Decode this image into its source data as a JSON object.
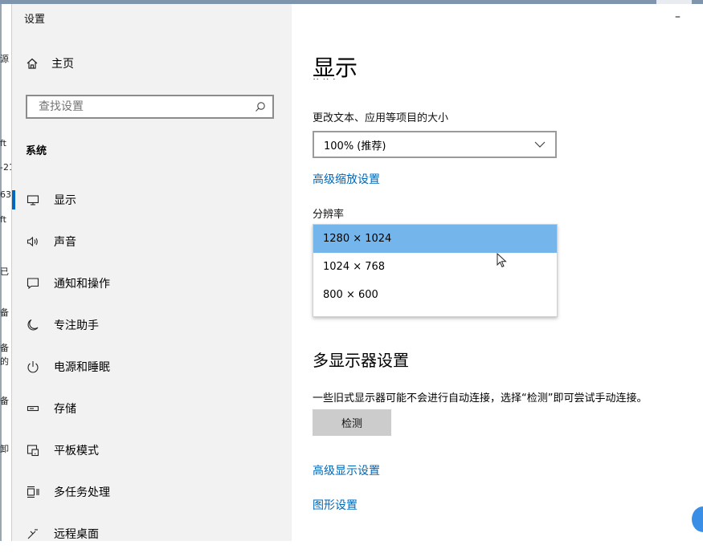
{
  "window": {
    "title": "设置",
    "minimize_glyph": "–"
  },
  "background_window": {
    "fragments": [
      "源",
      "ft",
      "-21",
      "63",
      "ft",
      "已",
      "备",
      "备",
      "的",
      "备",
      "卸"
    ]
  },
  "sidebar": {
    "home_label": "主页",
    "search_placeholder": "查找设置",
    "section_label": "系统",
    "items": [
      {
        "label": "显示",
        "icon": "monitor-icon",
        "active": true
      },
      {
        "label": "声音",
        "icon": "speaker-icon"
      },
      {
        "label": "通知和操作",
        "icon": "notification-icon"
      },
      {
        "label": "专注助手",
        "icon": "moon-icon"
      },
      {
        "label": "电源和睡眠",
        "icon": "power-icon"
      },
      {
        "label": "存储",
        "icon": "storage-icon"
      },
      {
        "label": "平板模式",
        "icon": "tablet-icon"
      },
      {
        "label": "多任务处理",
        "icon": "multitask-icon"
      },
      {
        "label": "远程桌面",
        "icon": "remote-desktop-icon"
      }
    ]
  },
  "main": {
    "title": "显示",
    "scale_label": "更改文本、应用等项目的大小",
    "scale_value": "100% (推荐)",
    "advanced_scaling_link": "高级缩放设置",
    "resolution_label": "分辨率",
    "resolution_options": [
      "1280 × 1024",
      "1024 × 768",
      "800 × 600"
    ],
    "resolution_selected_index": 0,
    "multi_display_heading": "多显示器设置",
    "multi_display_desc": "一些旧式显示器可能不会进行自动连接，选择“检测”即可尝试手动连接。",
    "detect_button": "检测",
    "advanced_display_link": "高级显示设置",
    "graphics_link": "图形设置"
  },
  "colors": {
    "accent": "#0067c0",
    "link": "#0067b8",
    "selected_option": "#74b6ec",
    "sidebar_bg": "#f2f2f2"
  }
}
